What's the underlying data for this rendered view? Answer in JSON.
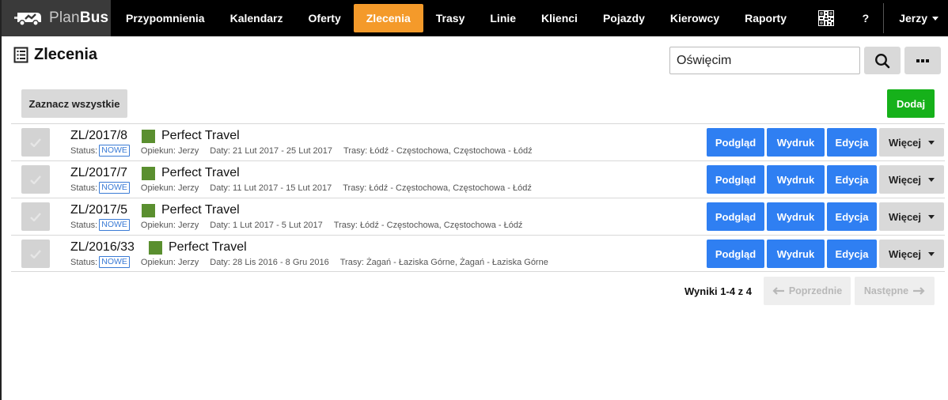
{
  "brand": {
    "plan": "Plan",
    "bus": "Bus"
  },
  "nav": {
    "items": [
      {
        "label": "Przypomnienia",
        "active": false
      },
      {
        "label": "Kalendarz",
        "active": false
      },
      {
        "label": "Oferty",
        "active": false
      },
      {
        "label": "Zlecenia",
        "active": true
      },
      {
        "label": "Trasy",
        "active": false
      },
      {
        "label": "Linie",
        "active": false
      },
      {
        "label": "Klienci",
        "active": false
      },
      {
        "label": "Pojazdy",
        "active": false
      },
      {
        "label": "Kierowcy",
        "active": false
      },
      {
        "label": "Raporty",
        "active": false
      }
    ],
    "help": "?",
    "user": "Jerzy"
  },
  "colors": {
    "accent": "#f49a2a",
    "primary": "#2f7ff2",
    "success": "#16b11a",
    "client": "#5a8f2f"
  },
  "header": {
    "title": "Zlecenia",
    "search_value": "Oświęcim"
  },
  "toolbar": {
    "select_all": "Zaznacz wszystkie",
    "add": "Dodaj"
  },
  "labels": {
    "status": "Status:",
    "preview": "Podgląd",
    "print": "Wydruk",
    "edit": "Edycja",
    "more": "Więcej"
  },
  "orders": [
    {
      "code": "ZL/2017/8",
      "client": "Perfect Travel",
      "status": "NOWE",
      "guardian": "Opiekun: Jerzy",
      "dates": "Daty: 21 Lut 2017 - 25 Lut 2017",
      "routes": "Trasy: Łódź - Częstochowa, Częstochowa - Łódź"
    },
    {
      "code": "ZL/2017/7",
      "client": "Perfect Travel",
      "status": "NOWE",
      "guardian": "Opiekun: Jerzy",
      "dates": "Daty: 11 Lut 2017 - 15 Lut 2017",
      "routes": "Trasy: Łódź - Częstochowa, Częstochowa - Łódź"
    },
    {
      "code": "ZL/2017/5",
      "client": "Perfect Travel",
      "status": "NOWE",
      "guardian": "Opiekun: Jerzy",
      "dates": "Daty: 1 Lut 2017 - 5 Lut 2017",
      "routes": "Trasy: Łódź - Częstochowa, Częstochowa - Łódź"
    },
    {
      "code": "ZL/2016/33",
      "client": "Perfect Travel",
      "status": "NOWE",
      "guardian": "Opiekun: Jerzy",
      "dates": "Daty: 28 Lis 2016 - 8 Gru 2016",
      "routes": "Trasy: Żagań - Łaziska Górne, Żagań - Łaziska Górne"
    }
  ],
  "pagination": {
    "results": "Wyniki 1-4 z 4",
    "prev": "Poprzednie",
    "next": "Następne"
  }
}
